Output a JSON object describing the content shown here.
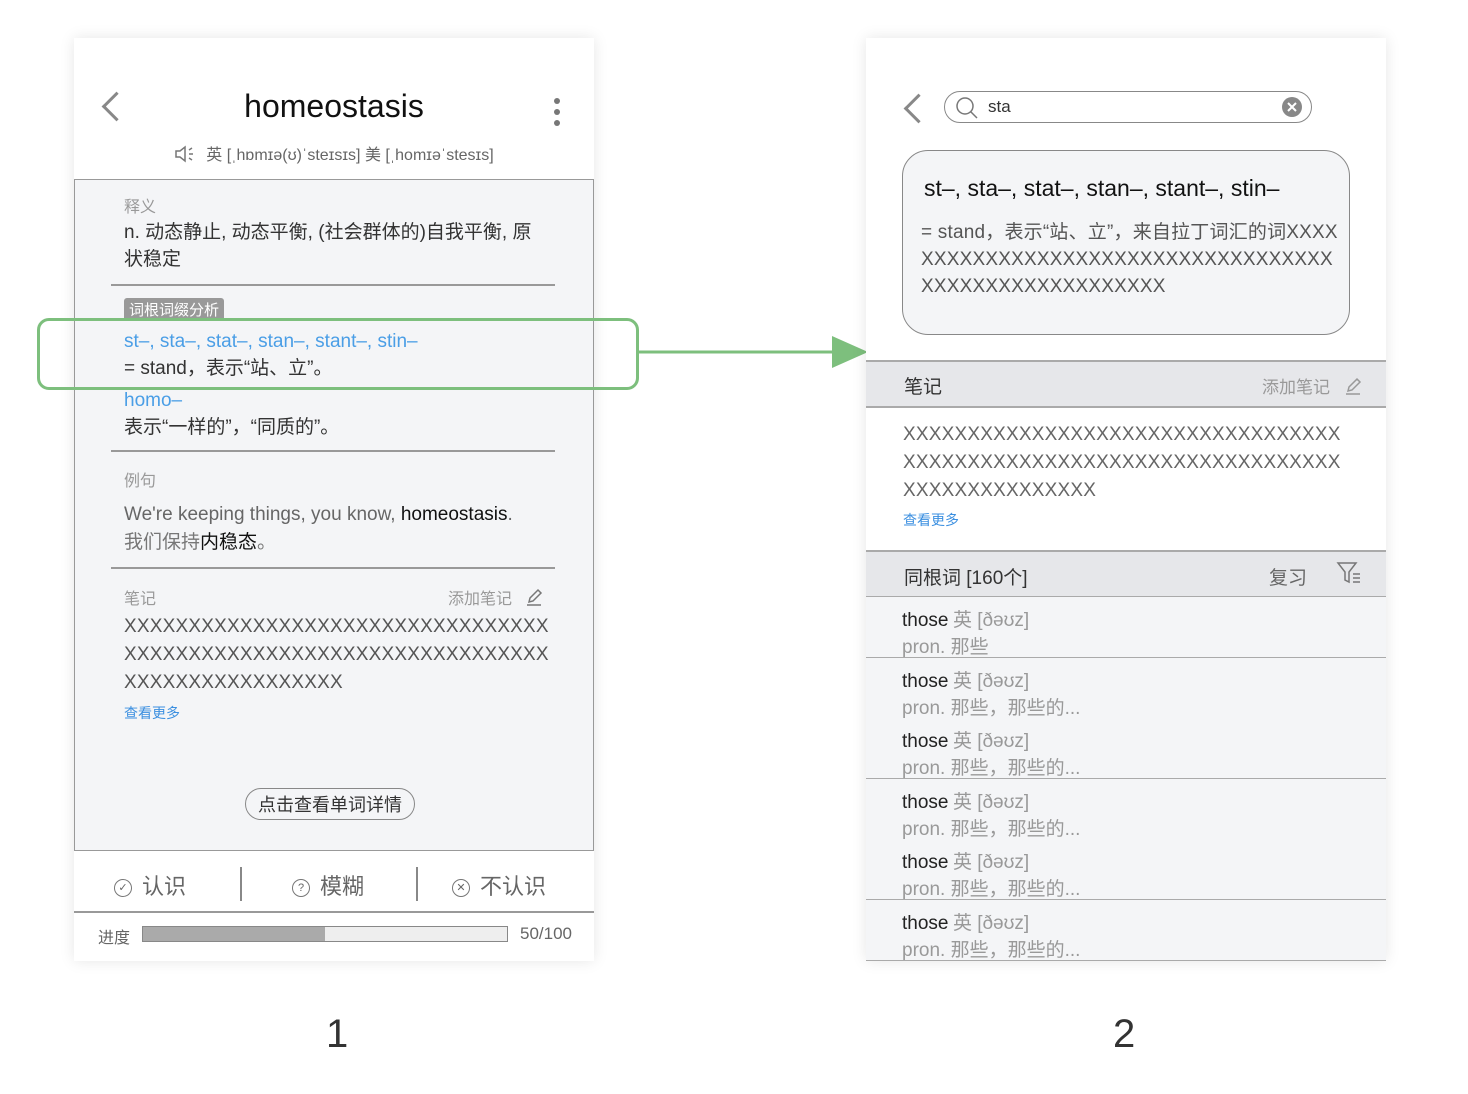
{
  "screen1": {
    "title": "homeostasis",
    "phonetic": "英 [ˌhɒmɪə(ʊ)ˈsteɪsɪs]  美 [ˌhomɪəˈstesɪs]",
    "definition_label": "释义",
    "definition_text": "n. 动态静止, 动态平衡, (社会群体的)自我平衡, 原状稳定",
    "root_tag": "词根词缀分析",
    "root1_title": "st–, sta–, stat–, stan–, stant–, stin–",
    "root1_desc": "= stand，表示“站、立”。",
    "root2_title": "homo–",
    "root2_desc": "表示“一样的”，“同质的”。",
    "example_label": "例句",
    "example_en_pre": "We're keeping things, you know, ",
    "example_en_word": "homeostasis",
    "example_en_post": ".",
    "example_cn_pre": "我们保持",
    "example_cn_word": "内稳态",
    "example_cn_post": "。",
    "notes_label": "笔记",
    "add_note": "添加笔记",
    "notes_text": "XXXXXXXXXXXXXXXXXXXXXXXXXXXXXXXXXXXXXXXXXXXXXXXXXXXXXXXXXXXXXXXXXXXXXXXXXXXXXXXXXXX",
    "view_more": "查看更多",
    "detail_button": "点击查看单词详情",
    "btn_know": "认识",
    "btn_fuzzy": "模糊",
    "btn_unknown": "不认识",
    "progress_label": "进度",
    "progress_text": "50/100",
    "progress_value": 0.5
  },
  "screen2": {
    "search_value": "sta",
    "card_title": "st–, sta–, stat–, stan–, stant–, stin–",
    "card_text": "= stand，表示“站、立”，来自拉丁词汇的词XXXXXXXXXXXXXXXXXXXXXXXXXXXXXXXXXXXXXXXXXXXXXXXXXXXXXXX",
    "notes_label": "笔记",
    "add_note": "添加笔记",
    "notes_text": "XXXXXXXXXXXXXXXXXXXXXXXXXXXXXXXXXXXXXXXXXXXXXXXXXXXXXXXXXXXXXXXXXXXXXXXXXXXXXXXXXXX",
    "view_more": "查看更多",
    "cognate_label": "同根词 [160个]",
    "review_label": "复习",
    "words": [
      {
        "word": "those",
        "phon": "英 [ðəʊz]",
        "def": "pron. 那些"
      },
      {
        "word": "those",
        "phon": "英 [ðəʊz]",
        "def": "pron. 那些，那些的..."
      },
      {
        "word": "those",
        "phon": "英 [ðəʊz]",
        "def": "pron. 那些，那些的..."
      },
      {
        "word": "those",
        "phon": "英 [ðəʊz]",
        "def": "pron. 那些，那些的..."
      },
      {
        "word": "those",
        "phon": "英 [ðəʊz]",
        "def": "pron. 那些，那些的..."
      },
      {
        "word": "those",
        "phon": "英 [ðəʊz]",
        "def": "pron. 那些，那些的..."
      }
    ]
  },
  "labels": {
    "one": "1",
    "two": "2"
  },
  "colors": {
    "highlight": "#7dbf7d",
    "link": "#4a9ee6"
  }
}
